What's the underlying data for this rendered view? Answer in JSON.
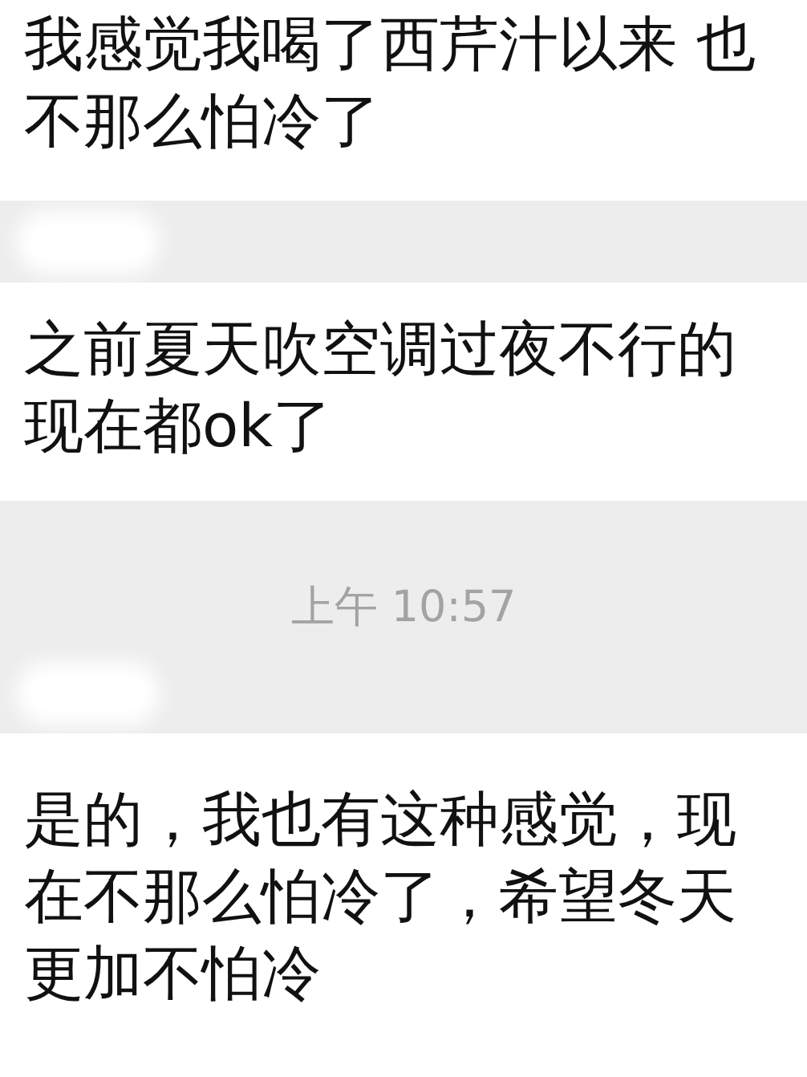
{
  "chat": [
    {
      "kind": "message",
      "text": "我感觉我喝了西芹汁以来 也不那么怕冷了"
    },
    {
      "kind": "avatar"
    },
    {
      "kind": "message",
      "text": "之前夏天吹空调过夜不行的现在都ok了"
    },
    {
      "kind": "time",
      "text": "上午 10:57"
    },
    {
      "kind": "avatar"
    },
    {
      "kind": "message",
      "text": "是的，我也有这种感觉，现在不那么怕冷了，希望冬天更加不怕冷"
    }
  ]
}
